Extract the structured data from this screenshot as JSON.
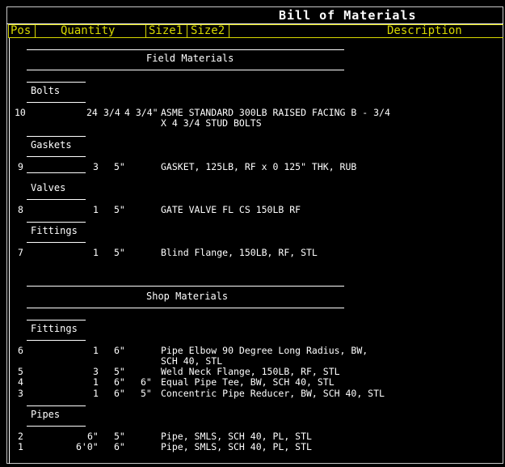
{
  "title": "Bill of Materials",
  "columns": {
    "pos": "Pos",
    "quantity": "Quantity",
    "size1": "Size1",
    "size2": "Size2",
    "description": "Description"
  },
  "sections": {
    "field": "Field Materials",
    "shop": "Shop Materials"
  },
  "groups": {
    "bolts": "Bolts",
    "gaskets": "Gaskets",
    "valves": "Valves",
    "fittings_field": "Fittings",
    "fittings_shop": "Fittings",
    "pipes": "Pipes"
  },
  "rows": [
    {
      "pos": "10",
      "qty": "24",
      "size1": "3/4",
      "size2": "4 3/4\"",
      "desc1": "ASME STANDARD 300LB RAISED FACING B - 3/4",
      "desc2": "X 4 3/4 STUD BOLTS"
    },
    {
      "pos": "9",
      "qty": "3",
      "size1": "5\"",
      "size2": "",
      "desc1": "GASKET, 125LB, RF x 0 125\" THK, RUB",
      "desc2": ""
    },
    {
      "pos": "8",
      "qty": "1",
      "size1": "5\"",
      "size2": "",
      "desc1": "GATE VALVE FL CS 150LB RF",
      "desc2": ""
    },
    {
      "pos": "7",
      "qty": "1",
      "size1": "5\"",
      "size2": "",
      "desc1": "Blind Flange, 150LB, RF, STL",
      "desc2": ""
    },
    {
      "pos": "6",
      "qty": "1",
      "size1": "6\"",
      "size2": "",
      "desc1": "Pipe Elbow 90 Degree Long Radius, BW,",
      "desc2": "SCH 40, STL"
    },
    {
      "pos": "5",
      "qty": "3",
      "size1": "5\"",
      "size2": "",
      "desc1": "Weld Neck Flange, 150LB, RF, STL",
      "desc2": ""
    },
    {
      "pos": "4",
      "qty": "1",
      "size1": "6\"",
      "size2": "6\"",
      "desc1": "Equal Pipe Tee, BW, SCH 40, STL",
      "desc2": ""
    },
    {
      "pos": "3",
      "qty": "1",
      "size1": "6\"",
      "size2": "5\"",
      "desc1": "Concentric Pipe Reducer, BW, SCH 40, STL",
      "desc2": ""
    },
    {
      "pos": "2",
      "qty": "6\"",
      "size1": "5\"",
      "size2": "",
      "desc1": "Pipe, SMLS, SCH 40, PL, STL",
      "desc2": ""
    },
    {
      "pos": "1",
      "qty": "6'0\"",
      "size1": "6\"",
      "size2": "",
      "desc1": "Pipe, SMLS, SCH 40, PL, STL",
      "desc2": ""
    }
  ],
  "colors": {
    "header": "#d8d800",
    "text": "#ffffff",
    "background": "#000000"
  }
}
